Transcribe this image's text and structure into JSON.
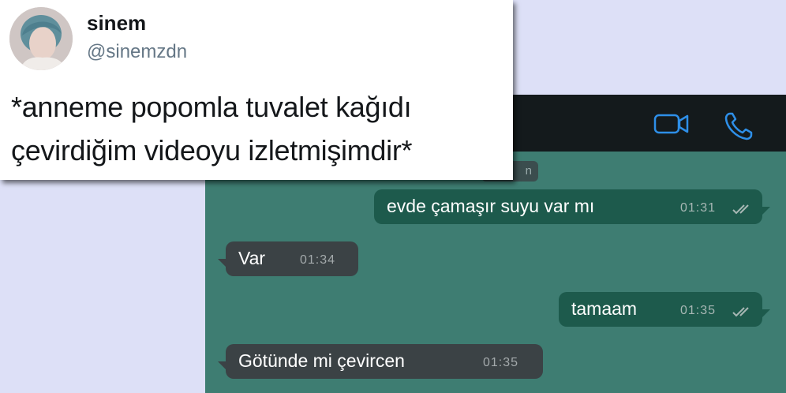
{
  "tweet": {
    "display_name": "sinem",
    "handle": "@sinemzdn",
    "text_line1": "*anneme popomla tuvalet kağıdı",
    "text_line2": "çevirdiğim videoyu izletmişimdir*"
  },
  "chat": {
    "date_chip": "n",
    "messages": [
      {
        "direction": "out",
        "text": "evde çamaşır suyu var mı",
        "time": "01:31",
        "status": "read-ticks"
      },
      {
        "direction": "in",
        "text": "Var",
        "time": "01:34"
      },
      {
        "direction": "out",
        "text": "tamaam",
        "time": "01:35",
        "status": "read-ticks"
      },
      {
        "direction": "in",
        "text": "Götünde mi çevircen",
        "time": "01:35"
      }
    ],
    "icons": [
      "video-call-icon",
      "voice-call-icon",
      "double-check-icon"
    ],
    "colors": {
      "background": "#3e7d72",
      "outgoing_bubble": "#1d5a4c",
      "incoming_bubble": "#3b4245",
      "accent_blue": "#2e8fe8"
    }
  }
}
